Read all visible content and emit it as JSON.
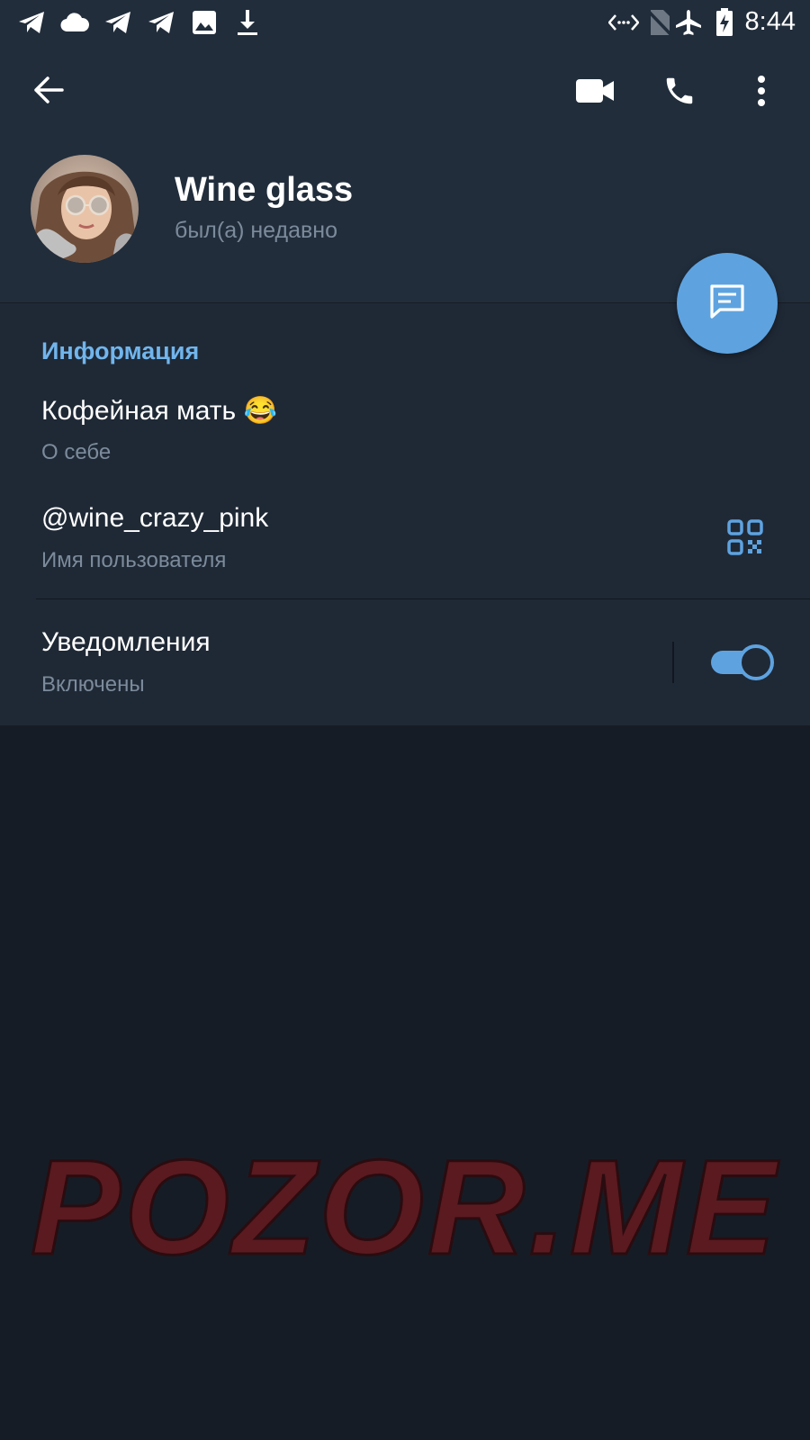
{
  "status_bar": {
    "time": "8:44",
    "left_icons": [
      "telegram-icon",
      "cloud-icon",
      "telegram-icon",
      "telegram-icon",
      "image-icon",
      "download-icon"
    ],
    "right_icons": [
      "data-transfer-icon",
      "no-sim-icon",
      "airplane-icon",
      "battery-charging-icon"
    ]
  },
  "toolbar": {
    "back": "back-arrow-icon",
    "video_call": "video-camera-icon",
    "call": "phone-icon",
    "menu": "more-vert-icon"
  },
  "profile": {
    "name": "Wine glass",
    "status": "был(а) недавно"
  },
  "fab": {
    "icon": "message-icon"
  },
  "info": {
    "title": "Информация",
    "bio": "Кофейная мать 😂",
    "bio_label": "О себе",
    "username": "@wine_crazy_pink",
    "username_label": "Имя пользователя",
    "notifications": "Уведомления",
    "notifications_state": "Включены",
    "notifications_enabled": true
  },
  "watermark": "POZOR.ME",
  "colors": {
    "accent": "#5ea3e0",
    "section_title": "#71b5ec",
    "header_bg": "#212d3b",
    "section_bg": "#1f2936",
    "page_bg": "#161c25"
  }
}
